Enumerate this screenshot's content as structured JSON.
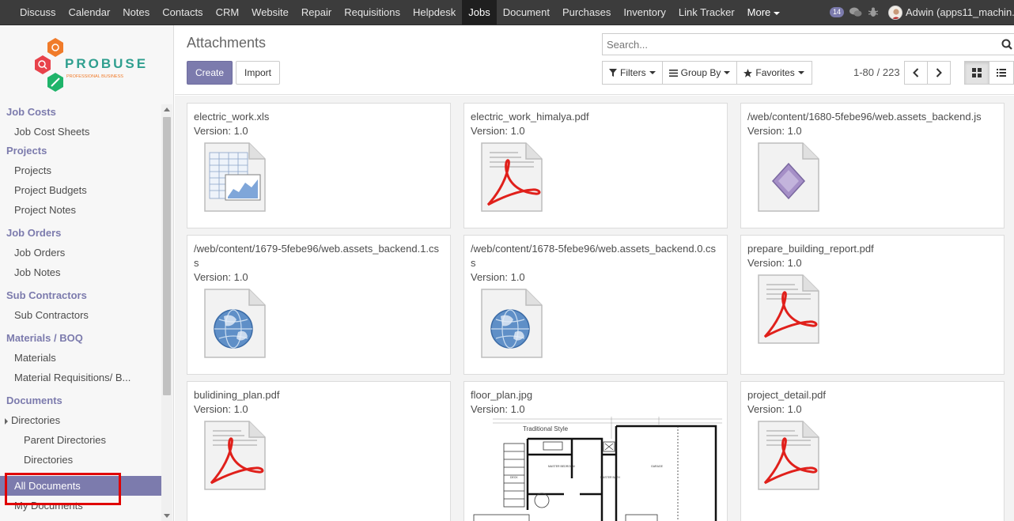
{
  "navbar": {
    "menu": [
      "Discuss",
      "Calendar",
      "Notes",
      "Contacts",
      "CRM",
      "Website",
      "Repair",
      "Requisitions",
      "Helpdesk",
      "Jobs",
      "Document",
      "Purchases",
      "Inventory",
      "Link Tracker"
    ],
    "active": "Jobs",
    "more_label": "More",
    "notification_count": "14",
    "user_name": "Adwin (apps11_machin..."
  },
  "logo": {
    "name": "PROBUSE",
    "tagline": "PROFESSIONAL BUSINESS"
  },
  "sidebar": {
    "sections": [
      {
        "title": "Job Costs",
        "items": [
          "Job Cost Sheets"
        ]
      },
      {
        "title": "Projects",
        "items": [
          "Projects",
          "Project Budgets",
          "Project Notes"
        ]
      },
      {
        "title": "Job Orders",
        "items": [
          "Job Orders",
          "Job Notes"
        ]
      },
      {
        "title": "Sub Contractors",
        "items": [
          "Sub Contractors"
        ]
      },
      {
        "title": "Materials / BOQ",
        "items": [
          "Materials",
          "Material Requisitions/ B..."
        ]
      },
      {
        "title": "Documents",
        "items": [
          "Directories",
          "Parent Directories",
          "Directories",
          "All Documents",
          "My Documents"
        ]
      }
    ],
    "active_item": "All Documents"
  },
  "control": {
    "title": "Attachments",
    "create_label": "Create",
    "import_label": "Import",
    "search_placeholder": "Search...",
    "filters_label": "Filters",
    "groupby_label": "Group By",
    "favorites_label": "Favorites",
    "pager": "1-80 / 223"
  },
  "cards": [
    {
      "name": "electric_work.xls",
      "version": "Version: 1.0",
      "icon": "spreadsheet-icon"
    },
    {
      "name": "electric_work_himalya.pdf",
      "version": "Version: 1.0",
      "icon": "pdf-icon"
    },
    {
      "name": "/web/content/1680-5febe96/web.assets_backend.js",
      "version": "Version: 1.0",
      "icon": "javascript-file-icon"
    },
    {
      "name": "/web/content/1679-5febe96/web.assets_backend.1.css",
      "version": "Version: 1.0",
      "icon": "web-file-icon"
    },
    {
      "name": "/web/content/1678-5febe96/web.assets_backend.0.css",
      "version": "Version: 1.0",
      "icon": "web-file-icon"
    },
    {
      "name": "prepare_building_report.pdf",
      "version": "Version: 1.0",
      "icon": "pdf-icon"
    },
    {
      "name": "bulidining_plan.pdf",
      "version": "Version: 1.0",
      "icon": "pdf-icon"
    },
    {
      "name": "floor_plan.jpg",
      "version": "Version: 1.0",
      "icon": "floor-plan-image"
    },
    {
      "name": "project_detail.pdf",
      "version": "Version: 1.0",
      "icon": "pdf-icon"
    }
  ],
  "floorplan": {
    "title": "Traditional Style",
    "rooms": [
      "MASTER BEDROOM",
      "GARAGE",
      "MASTER BATH",
      "DECK"
    ]
  },
  "colors": {
    "navbar_bg": "#3c3c3c",
    "accent": "#7c7bad",
    "highlight_box": "#e00000",
    "pdf_red": "#e0201b"
  }
}
